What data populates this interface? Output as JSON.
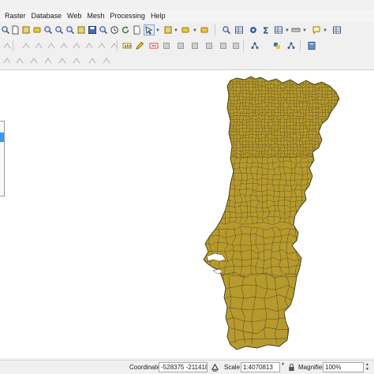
{
  "menubar": {
    "items": [
      "Raster",
      "Database",
      "Web",
      "Mesh",
      "Processing",
      "Help"
    ]
  },
  "toolbars": {
    "row1_icons": [
      "open-project-icon",
      "save-icon",
      "new-print-layout-icon",
      "style-manager-icon",
      "touch-zoom-icon",
      "zoom-in-icon",
      "zoom-out-icon",
      "zoom-selection-icon",
      "zoom-full-icon",
      "zoom-layer-icon",
      "zoom-last-icon",
      "zoom-next-icon",
      "new-map-view-icon",
      "temporal-controller-icon",
      "refresh-icon",
      "select-features-icon",
      "select-by-value-icon",
      "deselect-icon",
      "identify-icon",
      "open-attribute-table-icon",
      "field-calculator-icon",
      "statistics-icon",
      "measure-icon",
      "annotation-icon",
      "tips-icon"
    ],
    "row2_icons": [
      "digitize-icon",
      "edit-pencil-icon",
      "save-edits-icon",
      "add-feature-icon",
      "vertex-tool-icon",
      "delete-selected-icon",
      "cut-features-icon",
      "copy-features-icon",
      "paste-features-icon",
      "undo-icon",
      "redo-icon",
      "label-tool-icon",
      "diagram-icon",
      "pin-labels-icon",
      "show-hide-labels-icon",
      "move-label-icon",
      "rotate-label-icon",
      "change-label-icon",
      "python-console-icon",
      "plugins-icon",
      "graph-icon",
      "metasearch-icon"
    ],
    "row3_icons": [
      "advanced-digitizing-icon",
      "reshape-icon",
      "split-features-icon",
      "merge-features-icon",
      "offset-curve-icon",
      "simplify-icon",
      "add-ring-icon",
      "fill-ring-icon"
    ]
  },
  "map": {
    "layer": "Portugal municipal parishes (polygons)",
    "fill_color": "#b79a2d",
    "stroke_color": "#3e3a1a",
    "background": "#ffffff"
  },
  "statusbar": {
    "coordinate_label": "Coordinate",
    "coordinate_value": "-528375 -211418",
    "scale_label": "Scale",
    "scale_value": "1:4070813",
    "magnifier_label": "Magnifier",
    "magnifier_value": "100%"
  },
  "colors": {
    "accent": "#3399ff",
    "toolbar_bg": "#f0f0f0",
    "canvas_bg": "#ffffff"
  }
}
